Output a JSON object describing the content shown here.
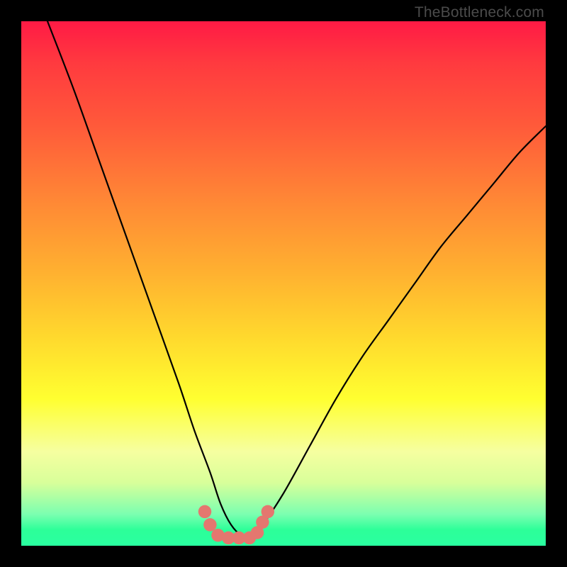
{
  "attribution": "TheBottleneck.com",
  "chart_data": {
    "type": "line",
    "title": "",
    "xlabel": "",
    "ylabel": "",
    "xlim": [
      0,
      100
    ],
    "ylim": [
      0,
      100
    ],
    "series": [
      {
        "name": "bottleneck-curve",
        "color": "#000000",
        "x": [
          5,
          10,
          15,
          20,
          25,
          30,
          33,
          36,
          38,
          40,
          42,
          44,
          46,
          50,
          55,
          60,
          65,
          70,
          75,
          80,
          85,
          90,
          95,
          100
        ],
        "values": [
          100,
          87,
          73,
          59,
          45,
          31,
          22,
          14,
          8,
          4,
          2,
          2,
          4,
          10,
          19,
          28,
          36,
          43,
          50,
          57,
          63,
          69,
          75,
          80
        ]
      }
    ],
    "markers": {
      "name": "trough-markers",
      "color": "#e4776f",
      "radius_pct": 1.25,
      "x": [
        35,
        36,
        37.5,
        39.5,
        41.5,
        43.5,
        45,
        46,
        47
      ],
      "values": [
        6.5,
        4,
        2,
        1.5,
        1.5,
        1.5,
        2.5,
        4.5,
        6.5
      ]
    }
  }
}
